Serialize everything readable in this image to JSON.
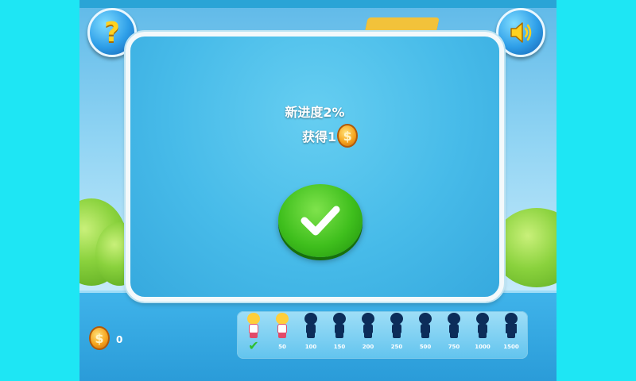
{
  "dialog": {
    "progress_text": "新进度2%",
    "earned_text": "获得1",
    "earned_coin_icon": "coin-icon",
    "confirm_icon": "check-icon"
  },
  "hud": {
    "help_label": "?",
    "help_icon": "question-icon",
    "sound_icon": "speaker-icon"
  },
  "bottom": {
    "coin_icon": "coin-icon",
    "coin_count": "0",
    "characters": [
      {
        "label": "",
        "unlocked": true,
        "selected": true
      },
      {
        "label": "50",
        "unlocked": true,
        "selected": false
      },
      {
        "label": "100",
        "unlocked": false,
        "selected": false
      },
      {
        "label": "150",
        "unlocked": false,
        "selected": false
      },
      {
        "label": "200",
        "unlocked": false,
        "selected": false
      },
      {
        "label": "250",
        "unlocked": false,
        "selected": false
      },
      {
        "label": "500",
        "unlocked": false,
        "selected": false
      },
      {
        "label": "750",
        "unlocked": false,
        "selected": false
      },
      {
        "label": "1000",
        "unlocked": false,
        "selected": false
      },
      {
        "label": "1500",
        "unlocked": false,
        "selected": false
      }
    ]
  },
  "colors": {
    "side_background": "#1ee6f4",
    "dialog_blue": "#47bbe9",
    "confirm_green": "#3fbf1d",
    "coin_gold": "#f6a41d",
    "locked_silhouette": "#0c2d5a"
  }
}
